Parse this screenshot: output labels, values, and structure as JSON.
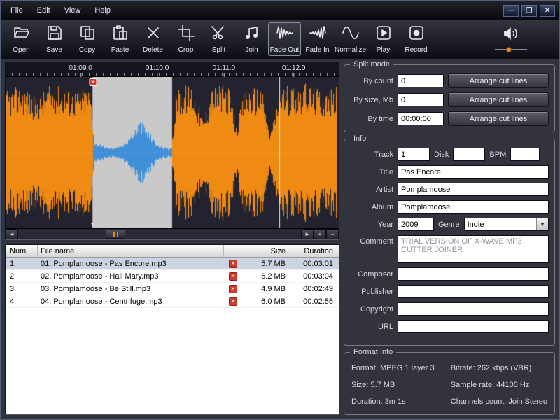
{
  "icons": {
    "minimize": "─",
    "maximize": "❐",
    "close": "✕",
    "x_mark": "✕",
    "down_arrow": "▼",
    "left_arrow": "◄",
    "right_arrow": "►",
    "plus": "+",
    "minus": "−",
    "dropdown": "▼"
  },
  "colors": {
    "waveform_background": "#232330",
    "waveform_orange": "#ef8a12",
    "selection_background": "#c9c9c9",
    "selection_blue": "#3f8fd9",
    "playhead_white": "#eeeef4"
  },
  "menu": {
    "items": [
      "File",
      "Edit",
      "View",
      "Help"
    ]
  },
  "toolbar": {
    "buttons": [
      {
        "label": "Open"
      },
      {
        "label": "Save"
      },
      {
        "label": "Copy"
      },
      {
        "label": "Paste"
      },
      {
        "label": "Delete"
      },
      {
        "label": "Crop"
      },
      {
        "label": "Split"
      },
      {
        "label": "Join"
      },
      {
        "label": "Fade Out",
        "active": true
      },
      {
        "label": "Fade In"
      },
      {
        "label": "Normalize"
      },
      {
        "label": "Play"
      },
      {
        "label": "Record"
      }
    ]
  },
  "waveform": {
    "time_labels": [
      "01:09.0",
      "01:10.0",
      "01:11.0",
      "01:12.0"
    ],
    "selection_start_fraction": 0.262,
    "selection_end_fraction": 0.502,
    "playhead_fraction": 0.825
  },
  "file_list": {
    "columns": [
      "Num.",
      "File name",
      "Size",
      "Duration"
    ],
    "rows": [
      {
        "num": "1",
        "name": "01. Pomplamoose - Pas Encore.mp3",
        "size": "5.7 MB",
        "duration": "00:03:01"
      },
      {
        "num": "2",
        "name": "02. Pomplamoose - Hail Mary.mp3",
        "size": "6.2 MB",
        "duration": "00:03:04"
      },
      {
        "num": "3",
        "name": "03. Pomplamoose - Be Still.mp3",
        "size": "4.9 MB",
        "duration": "00:02:49"
      },
      {
        "num": "4",
        "name": "04. Pomplamoose - Centrifuge.mp3",
        "size": "6.0 MB",
        "duration": "00:02:55"
      }
    ]
  },
  "split_mode": {
    "title": "Split mode",
    "count_label": "By count",
    "count_value": "0",
    "size_label": "By size, Mb",
    "size_value": "0",
    "time_label": "By time",
    "time_value": "00:00:00",
    "arrange_label": "Arrange cut lines"
  },
  "info": {
    "title": "Info",
    "track_label": "Track",
    "track_value": "1",
    "disk_label": "Disk",
    "disk_value": "",
    "bpm_label": "BPM",
    "bpm_value": "",
    "title_label": "Title",
    "title_value": "Pas Encore",
    "artist_label": "Artist",
    "artist_value": "Pomplamoose",
    "album_label": "Album",
    "album_value": "Pomplamoose",
    "year_label": "Year",
    "year_value": "2009",
    "genre_label": "Genre",
    "genre_value": "Indie",
    "comment_label": "Comment",
    "comment_value": "TRIAL VERSION OF X-WAVE MP3 CUTTER JOINER",
    "composer_label": "Composer",
    "publisher_label": "Publisher",
    "copyright_label": "Copyright",
    "url_label": "URL"
  },
  "format_info": {
    "title": "Format Info",
    "items": [
      "Format: MPEG 1 layer 3",
      "Bitrate: 262 kbps (VBR)",
      "Size: 5.7 MB",
      "Sample rate: 44100 Hz",
      "Duration: 3m 1s",
      "Channels count: Join Stereo"
    ]
  }
}
